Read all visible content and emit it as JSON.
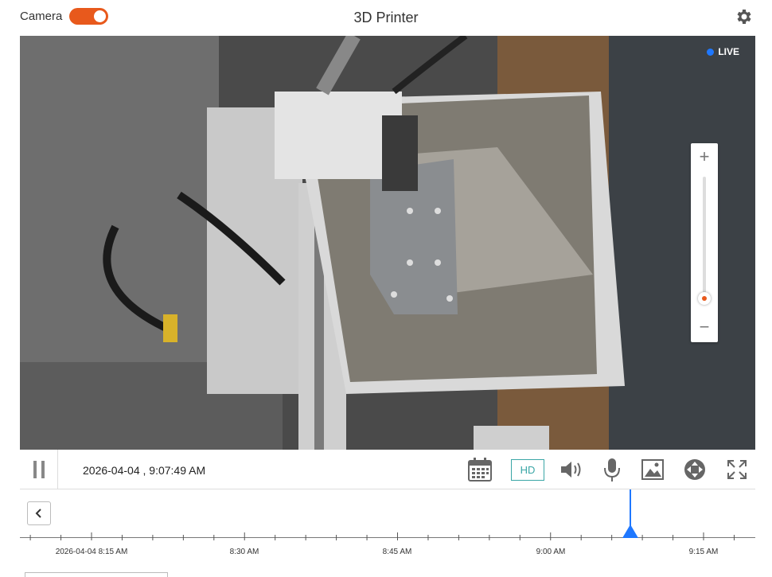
{
  "header": {
    "camera_label": "Camera",
    "camera_on": true,
    "title": "3D Printer"
  },
  "video": {
    "live_label": "LIVE"
  },
  "zoom": {
    "plus": "+",
    "minus": "−",
    "level": 0
  },
  "controls": {
    "timestamp": "2026-04-04 , 9:07:49 AM",
    "hd_label": "HD"
  },
  "timeline": {
    "ticks": [
      "2026-04-04 8:15 AM",
      "8:30 AM",
      "8:45 AM",
      "9:00 AM",
      "9:15 AM"
    ]
  },
  "colors": {
    "accent_orange": "#e8591c",
    "accent_blue": "#1f78ff",
    "hd_teal": "#3aa6a6"
  }
}
